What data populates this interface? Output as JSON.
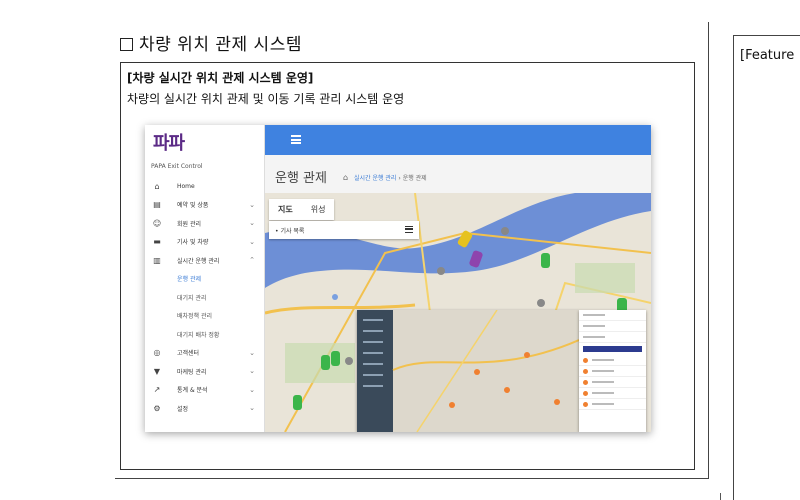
{
  "heading": "차량 위치 관제 시스템",
  "box": {
    "title": "[차량 실시간 위치 관제 시스템 운영]",
    "description": "차량의 실시간 위치 관제 및 이동 기록 관리 시스템 운영"
  },
  "side_label": "[Feature",
  "app": {
    "logo": "파파",
    "subtitle": "PAPA Exit Control",
    "menu": [
      {
        "icon": "⌂",
        "label": "Home",
        "chev": ""
      },
      {
        "icon": "▤",
        "label": "예약 및 상품",
        "chev": "⌄"
      },
      {
        "icon": "☺",
        "label": "회원 관리",
        "chev": "⌄"
      },
      {
        "icon": "▬",
        "label": "기사 및 차량",
        "chev": "⌄"
      },
      {
        "icon": "▥",
        "label": "실시간 운행 관리",
        "chev": "⌃"
      },
      {
        "icon": "",
        "label": "운행 관제",
        "chev": "",
        "sub": true,
        "active": true
      },
      {
        "icon": "",
        "label": "대기지 관리",
        "chev": "",
        "sub": true
      },
      {
        "icon": "",
        "label": "배차정책 관리",
        "chev": "",
        "sub": true
      },
      {
        "icon": "",
        "label": "대기지 배차 정황",
        "chev": "",
        "sub": true
      },
      {
        "icon": "◎",
        "label": "고객센터",
        "chev": "⌄"
      },
      {
        "icon": "▼",
        "label": "마케팅 관리",
        "chev": "⌄"
      },
      {
        "icon": "↗",
        "label": "통계 & 분석",
        "chev": "⌄"
      },
      {
        "icon": "⚙",
        "label": "설정",
        "chev": "⌄"
      }
    ],
    "page_title": "운행 관제",
    "breadcrumb": {
      "parent": "실시간 운행 관리",
      "current": "운행 관제"
    },
    "map_tabs": [
      "지도",
      "위성"
    ],
    "driver_list": "• 기사 목록"
  },
  "colors": {
    "topbar": "#3f82e0",
    "logo": "#5b2a86",
    "river": "#6d8fd6",
    "road": "#f2c14e"
  }
}
